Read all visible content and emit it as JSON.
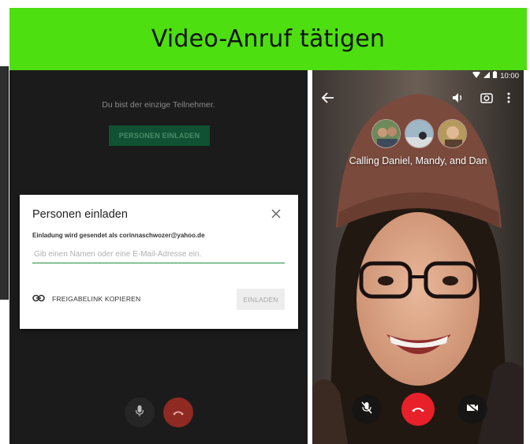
{
  "banner": {
    "title": "Video-Anruf tätigen"
  },
  "meeting": {
    "status_text": "Du bist der einzige Teilnehmer.",
    "invite_button_label": "PERSONEN EINLADEN",
    "dialog": {
      "title": "Personen einladen",
      "subtitle": "Einladung wird gesendet als corinnaschwozer@yahoo.de",
      "input_placeholder": "Gib einen Namen oder eine E-Mail-Adresse ein.",
      "copy_link_label": "FREIGABELINK KOPIEREN",
      "invite_button_label": "EINLADEN"
    }
  },
  "phone": {
    "time": "10:00",
    "calling_text": "Calling Daniel, Mandy, and Dan",
    "colors": {
      "end_call": "#e8202a",
      "banner": "#4ddf10",
      "accent": "#1e8e3e"
    }
  }
}
